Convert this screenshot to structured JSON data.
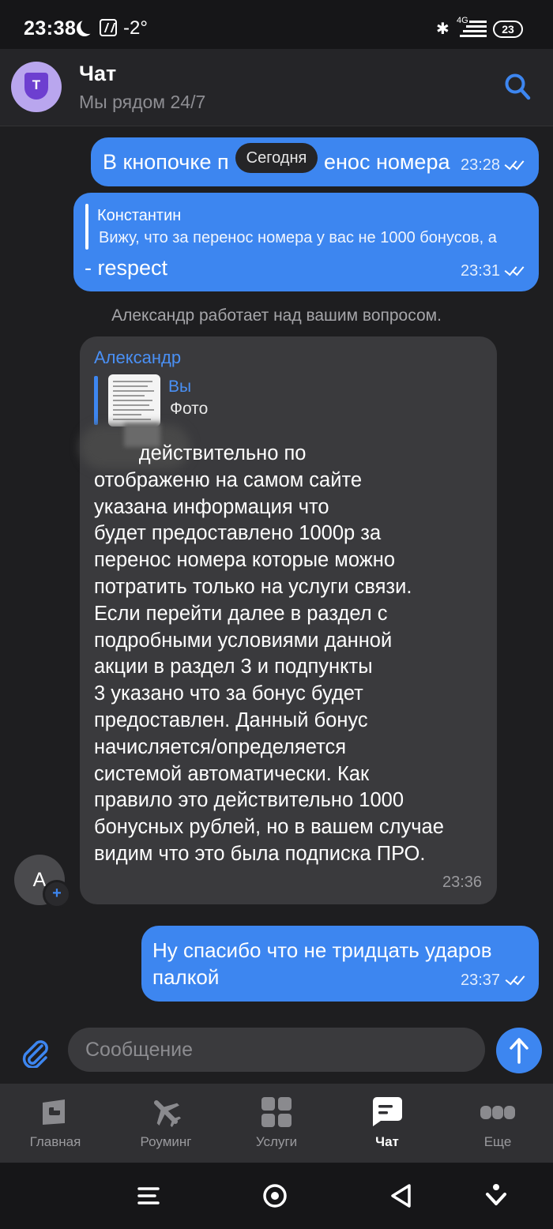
{
  "status_bar": {
    "time": "23:38",
    "temperature": "-2°",
    "network": "4G",
    "battery": "23"
  },
  "header": {
    "title": "Чат",
    "subtitle": "Мы рядом 24/7"
  },
  "date_badge": "Сегодня",
  "messages": [
    {
      "text": "В кнопочке п",
      "text_after": "енос номера",
      "time": "23:28"
    },
    {
      "reply_to": {
        "name": "Константин",
        "text": "Вижу, что за перенос номера у вас не 1000 бонусов, а"
      },
      "text": "- respect",
      "time": "23:31"
    },
    {
      "text": "Ну спасибо что не тридцать ударов\nпалкой",
      "time": "23:37"
    }
  ],
  "system_note": "Александр работает над вашим вопросом.",
  "agent_message": {
    "sender": "Александр",
    "avatar_letter": "А",
    "quote": {
      "name": "Вы",
      "text": "Фото"
    },
    "text": "        действительно по\nотображеню на самом сайте\nуказана информация что\nбудет предоставлено 1000р за\nперенос номера которые можно\nпотратить только на услуги связи.\nЕсли перейти далее в раздел с\nподробными условиями данной\nакции в раздел 3 и подпункты\n3 указано что за бонус будет\nпредоставлен. Данный бонус\nначисляется/определяется\nсистемой автоматически. Как\nправило это действительно 1000\nбонусных рублей, но в вашем случае\nвидим что это была подписка ПРО.",
    "time": "23:36"
  },
  "composer": {
    "placeholder": "Сообщение"
  },
  "tabs": [
    {
      "label": "Главная",
      "icon": "home-icon"
    },
    {
      "label": "Роуминг",
      "icon": "airplane-icon"
    },
    {
      "label": "Услуги",
      "icon": "services-grid-icon"
    },
    {
      "label": "Чат",
      "icon": "chat-icon",
      "active": true
    },
    {
      "label": "Еще",
      "icon": "more-dots-icon"
    }
  ],
  "colors": {
    "bg": "#1e1e20",
    "bubble_out": "#3d86f0",
    "bubble_in": "#3a3a3d",
    "header_bg": "#252528",
    "nav_bg": "#303033",
    "accent": "#3d86f0"
  }
}
